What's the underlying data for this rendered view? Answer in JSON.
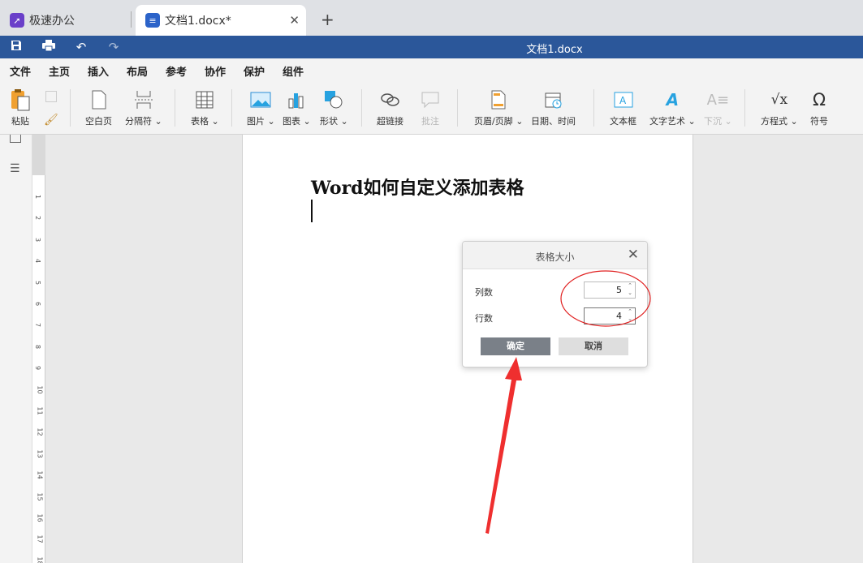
{
  "tabs": {
    "app_tab": "极速办公",
    "doc_tab": "文档1.docx*",
    "close_glyph": "✕",
    "new_tab_glyph": "+"
  },
  "titlebar": {
    "title": "文档1.docx"
  },
  "menu": [
    "文件",
    "主页",
    "插入",
    "布局",
    "参考",
    "协作",
    "保护",
    "组件"
  ],
  "ribbon": {
    "paste": "粘贴",
    "blank_page": "空白页",
    "separator": "分隔符",
    "table": "表格",
    "picture": "图片",
    "chart": "图表",
    "shape": "形状",
    "hyperlink": "超链接",
    "comment": "批注",
    "header_footer": "页眉/页脚",
    "datetime": "日期、时间",
    "textbox": "文本框",
    "wordart": "文字艺术",
    "dropcap": "下沉",
    "equation": "方程式",
    "symbol": "符号"
  },
  "document": {
    "heading": "Word如何自定义添加表格"
  },
  "ruler_ticks": [
    "1",
    "2",
    "3",
    "4",
    "5",
    "6",
    "7",
    "8",
    "9",
    "10",
    "11",
    "12",
    "13",
    "14",
    "15",
    "16",
    "17",
    "18"
  ],
  "dialog": {
    "title": "表格大小",
    "columns_label": "列数",
    "columns_value": "5",
    "rows_label": "行数",
    "rows_value": "4",
    "ok": "确定",
    "cancel": "取消"
  },
  "colors": {
    "brand_blue": "#2b579a",
    "annotation_red": "#e02020"
  }
}
